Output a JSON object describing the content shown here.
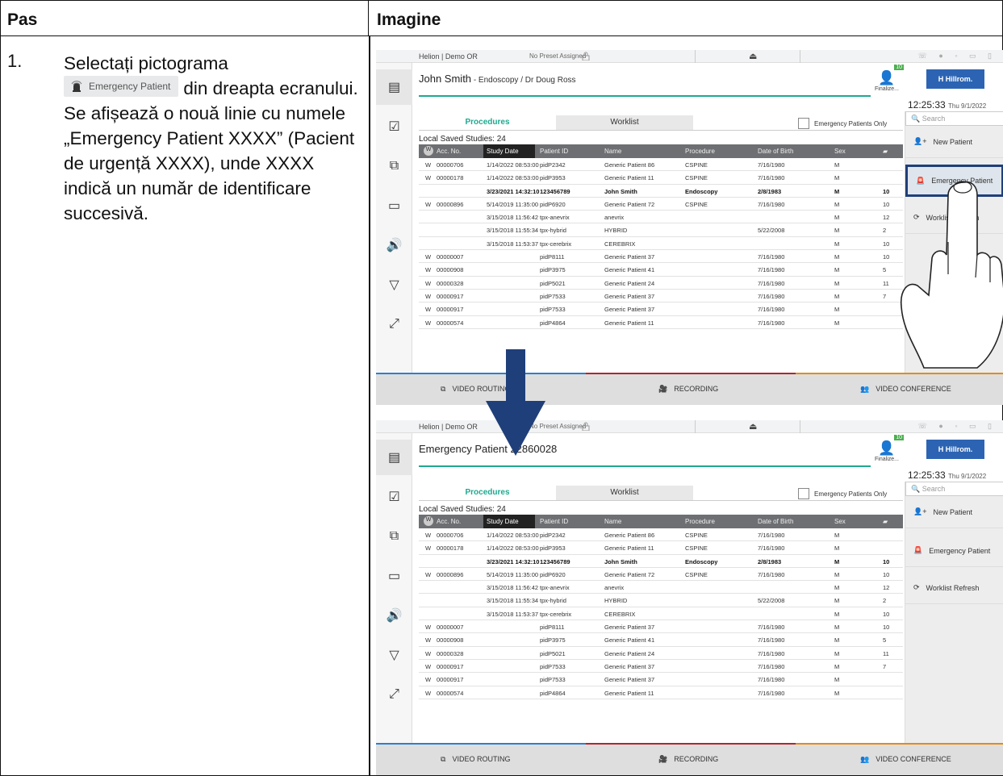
{
  "table": {
    "header_left": "Pas",
    "header_right": "Imagine"
  },
  "step": {
    "number": "1.",
    "line1": "Selectați pictograma",
    "chip_label": "Emergency Patient",
    "line2": "din dreapta ecranului.",
    "line3": "Se afișează o nouă linie cu numele „Emergency Patient XXXX” (Pacient de urgență XXXX), unde XXXX indică un număr de identificare succesivă."
  },
  "screens": [
    {
      "title_bar": "Helion | Demo OR",
      "preset": "No Preset Assigned",
      "patient_name": "John Smith",
      "patient_detail": " - Endoscopy / Dr Doug Ross",
      "highlight_emergency": true
    },
    {
      "title_bar": "Helion | Demo OR",
      "preset": "No Preset Assigned",
      "patient_name": "Emergency Patient 22860028",
      "patient_detail": "",
      "highlight_emergency": false
    }
  ],
  "common": {
    "finalize": "Finalize...",
    "badge": "10",
    "brand": "Hillrom.",
    "time": "12:25:33",
    "date": "Thu 9/1/2022",
    "tab_procedures": "Procedures",
    "tab_worklist": "Worklist",
    "emergency_only": "Emergency Patients Only",
    "local_saved": "Local Saved Studies: 24",
    "search_placeholder": "Search",
    "btn_new_patient": "New Patient",
    "btn_emergency": "Emergency Patient",
    "btn_worklist_refresh": "Worklist Refresh",
    "bottom_video_routing": "VIDEO ROUTING",
    "bottom_recording": "RECORDING",
    "bottom_video_conference": "VIDEO CONFERENCE",
    "columns": [
      "W",
      "Acc. No.",
      "Study Date",
      "Patient ID",
      "Name",
      "Procedure",
      "Date of Birth",
      "Sex",
      ""
    ],
    "rows": [
      [
        "W",
        "00000706",
        "1/14/2022 08:53:00",
        "pidP2342",
        "Generic Patient 86",
        "CSPINE",
        "7/16/1980",
        "M",
        ""
      ],
      [
        "W",
        "00000178",
        "1/14/2022 08:53:00",
        "pidP3953",
        "Generic Patient 11",
        "CSPINE",
        "7/16/1980",
        "M",
        ""
      ],
      [
        "",
        "",
        "3/23/2021 14:32:10",
        "123456789",
        "John Smith",
        "Endoscopy",
        "2/8/1983",
        "M",
        "10"
      ],
      [
        "W",
        "00000896",
        "5/14/2019 11:35:00",
        "pidP6920",
        "Generic Patient 72",
        "CSPINE",
        "7/16/1980",
        "M",
        "10"
      ],
      [
        "",
        "",
        "3/15/2018 11:56:42",
        "tpx-anevrix",
        "anevrix",
        "",
        "",
        "M",
        "12"
      ],
      [
        "",
        "",
        "3/15/2018 11:55:34",
        "tpx-hybrid",
        "HYBRID",
        "",
        "5/22/2008",
        "M",
        "2"
      ],
      [
        "",
        "",
        "3/15/2018 11:53:37",
        "tpx-cerebrix",
        "CEREBRIX",
        "",
        "",
        "M",
        "10"
      ],
      [
        "W",
        "00000007",
        "",
        "pidP8111",
        "Generic Patient 37",
        "",
        "7/16/1980",
        "M",
        "10"
      ],
      [
        "W",
        "00000908",
        "",
        "pidP3975",
        "Generic Patient 41",
        "",
        "7/16/1980",
        "M",
        "5"
      ],
      [
        "W",
        "00000328",
        "",
        "pidP5021",
        "Generic Patient 24",
        "",
        "7/16/1980",
        "M",
        "11"
      ],
      [
        "W",
        "00000917",
        "",
        "pidP7533",
        "Generic Patient 37",
        "",
        "7/16/1980",
        "M",
        "7"
      ],
      [
        "W",
        "00000917",
        "",
        "pidP7533",
        "Generic Patient 37",
        "",
        "7/16/1980",
        "M",
        ""
      ],
      [
        "W",
        "00000574",
        "",
        "pidP4864",
        "Generic Patient 11",
        "",
        "7/16/1980",
        "M",
        ""
      ]
    ]
  },
  "colors": {
    "accent_teal": "#1ea98f",
    "brand_blue": "#2c64b3",
    "highlight_border": "#1f3f7a",
    "arrow": "#1f3f7a",
    "routing_line": "#2c7fd0",
    "recording_line": "#b3262c",
    "conference_line": "#e38b1c"
  }
}
